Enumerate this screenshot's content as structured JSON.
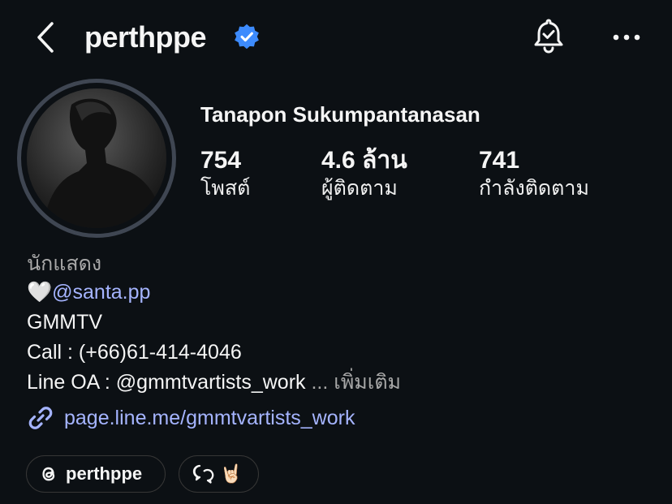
{
  "header": {
    "username": "perthppe",
    "verified": true,
    "icons": {
      "back": "chevron-left-icon",
      "verified": "verified-badge-icon",
      "notifications": "bell-check-icon",
      "more": "more-horizontal-icon"
    }
  },
  "profile": {
    "full_name": "Tanapon Sukumpantanasan",
    "stats": [
      {
        "value": "754",
        "label": "โพสต์"
      },
      {
        "value": "4.6 ล้าน",
        "label": "ผู้ติดตาม"
      },
      {
        "value": "741",
        "label": "กำลังติดตาม"
      }
    ]
  },
  "bio": {
    "category": "นักแสดง",
    "heart": "🤍",
    "mention": "@santa.pp",
    "line3": "GMMTV",
    "line4": "Call : (+66)61-414-4046",
    "line5": "Line OA : @gmmtvartists_work",
    "more": "... เพิ่มเติม",
    "link": "page.line.me/gmmtvartists_work"
  },
  "pills": {
    "threads_label": "perthppe",
    "threads_icon": "threads-icon",
    "chat_icon": "chat-bubbles-icon",
    "chat_emoji": "🤘🏻"
  },
  "colors": {
    "background": "#0c1014",
    "link": "#a5b4ff",
    "verified": "#3d8bfd",
    "muted": "#a8a8a8"
  }
}
